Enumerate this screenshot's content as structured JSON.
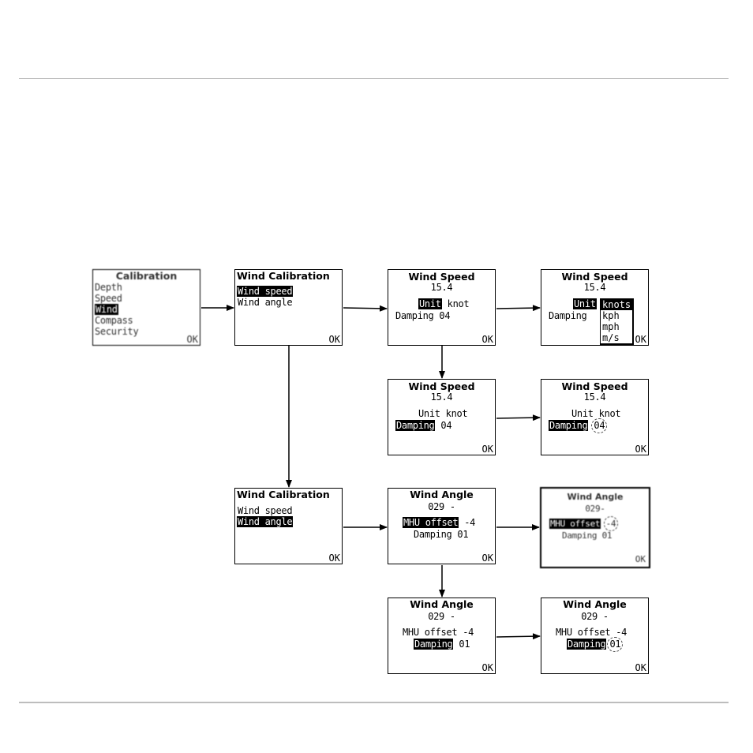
{
  "colors": {
    "line": "#000000",
    "highlight_bg": "#000000",
    "highlight_fg": "#ffffff",
    "rule": "#bdbdbd"
  },
  "ok_label": "OK",
  "screens": {
    "calibration": {
      "title": "Calibration",
      "items": [
        "Depth",
        "Speed",
        "Wind",
        "Compass",
        "Security"
      ],
      "selected": "Wind"
    },
    "wind_cal_speed": {
      "title": "Wind Calibration",
      "items": [
        "Wind speed",
        "Wind angle"
      ],
      "selected": "Wind speed"
    },
    "wind_speed_unit": {
      "title": "Wind Speed",
      "value": "15.4",
      "unit_label": "Unit",
      "unit_value": "knot",
      "damping_label": "Damping",
      "damping_value": "04"
    },
    "wind_speed_unit_dropdown": {
      "title": "Wind Speed",
      "value": "15.4",
      "unit_label": "Unit",
      "damping_label": "Damping",
      "options": [
        "knots",
        "kph",
        "mph",
        "m/s"
      ],
      "selected_option": "knots"
    },
    "wind_speed_damping": {
      "title": "Wind Speed",
      "value": "15.4",
      "unit_label": "Unit",
      "unit_value": "knot",
      "damping_label": "Damping",
      "damping_value": "04"
    },
    "wind_speed_damping_edit": {
      "title": "Wind Speed",
      "value": "15.4",
      "unit_label": "Unit",
      "unit_value": "knot",
      "damping_label": "Damping",
      "damping_value": "04"
    },
    "wind_cal_angle": {
      "title": "Wind Calibration",
      "items": [
        "Wind speed",
        "Wind angle"
      ],
      "selected": "Wind angle"
    },
    "wind_angle_offset": {
      "title": "Wind Angle",
      "value": "029 -",
      "offset_label": "MHU offset",
      "offset_value": "-4",
      "damping_label": "Damping",
      "damping_value": "01"
    },
    "wind_angle_offset_edit": {
      "title": "Wind Angle",
      "value": "029-",
      "offset_label": "MHU offset",
      "offset_value": "-4",
      "damping_label": "Damping",
      "damping_value": "01"
    },
    "wind_angle_damping": {
      "title": "Wind Angle",
      "value": "029 -",
      "offset_label": "MHU offset",
      "offset_value": "-4",
      "damping_label": "Damping",
      "damping_value": "01"
    },
    "wind_angle_damping_edit": {
      "title": "Wind Angle",
      "value": "029 -",
      "offset_label": "MHU offset",
      "offset_value": "-4",
      "damping_label": "Damping",
      "damping_value": "01"
    }
  },
  "flow": [
    {
      "from": "calibration",
      "to": "wind_cal_speed"
    },
    {
      "from": "wind_cal_speed",
      "to": "wind_speed_unit"
    },
    {
      "from": "wind_speed_unit",
      "to": "wind_speed_unit_dropdown"
    },
    {
      "from": "wind_speed_unit",
      "to": "wind_speed_damping"
    },
    {
      "from": "wind_speed_damping",
      "to": "wind_speed_damping_edit"
    },
    {
      "from": "wind_cal_speed",
      "to": "wind_cal_angle"
    },
    {
      "from": "wind_cal_angle",
      "to": "wind_angle_offset"
    },
    {
      "from": "wind_angle_offset",
      "to": "wind_angle_offset_edit"
    },
    {
      "from": "wind_angle_offset",
      "to": "wind_angle_damping"
    },
    {
      "from": "wind_angle_damping",
      "to": "wind_angle_damping_edit"
    }
  ]
}
